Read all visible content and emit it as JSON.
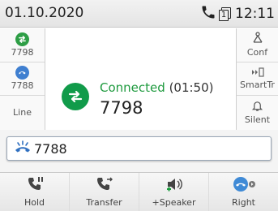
{
  "status_bar": {
    "date": "01.10.2020",
    "time": "12:11",
    "line_number": "1",
    "icons": [
      "phone-icon",
      "line-indicator-icon"
    ]
  },
  "left_keys": [
    {
      "label": "7798",
      "icon": "call-active-icon",
      "icon_color": "#2e9e46"
    },
    {
      "label": "7788",
      "icon": "call-held-icon",
      "icon_color": "#3f7fd0"
    },
    {
      "label": "Line",
      "icon": ""
    }
  ],
  "right_keys": [
    {
      "label": "Conf",
      "icon": "conference-icon"
    },
    {
      "label": "SmartTr",
      "icon": "smart-transfer-icon"
    },
    {
      "label": "Silent",
      "icon": "bell-icon"
    }
  ],
  "call": {
    "status": "Connected",
    "duration": "(01:50)",
    "number": "7798",
    "icon": "transfer-arrows-icon",
    "color": "#119b4a"
  },
  "dial_bar": {
    "number": "7788",
    "icon": "ringing-phone-icon"
  },
  "softkeys": [
    {
      "label": "Hold",
      "icon": "hold-phone-icon"
    },
    {
      "label": "Transfer",
      "icon": "transfer-phone-icon"
    },
    {
      "label": "+Speaker",
      "icon": "speaker-icon"
    },
    {
      "label": "Right",
      "icon": "right-call-icon"
    }
  ]
}
